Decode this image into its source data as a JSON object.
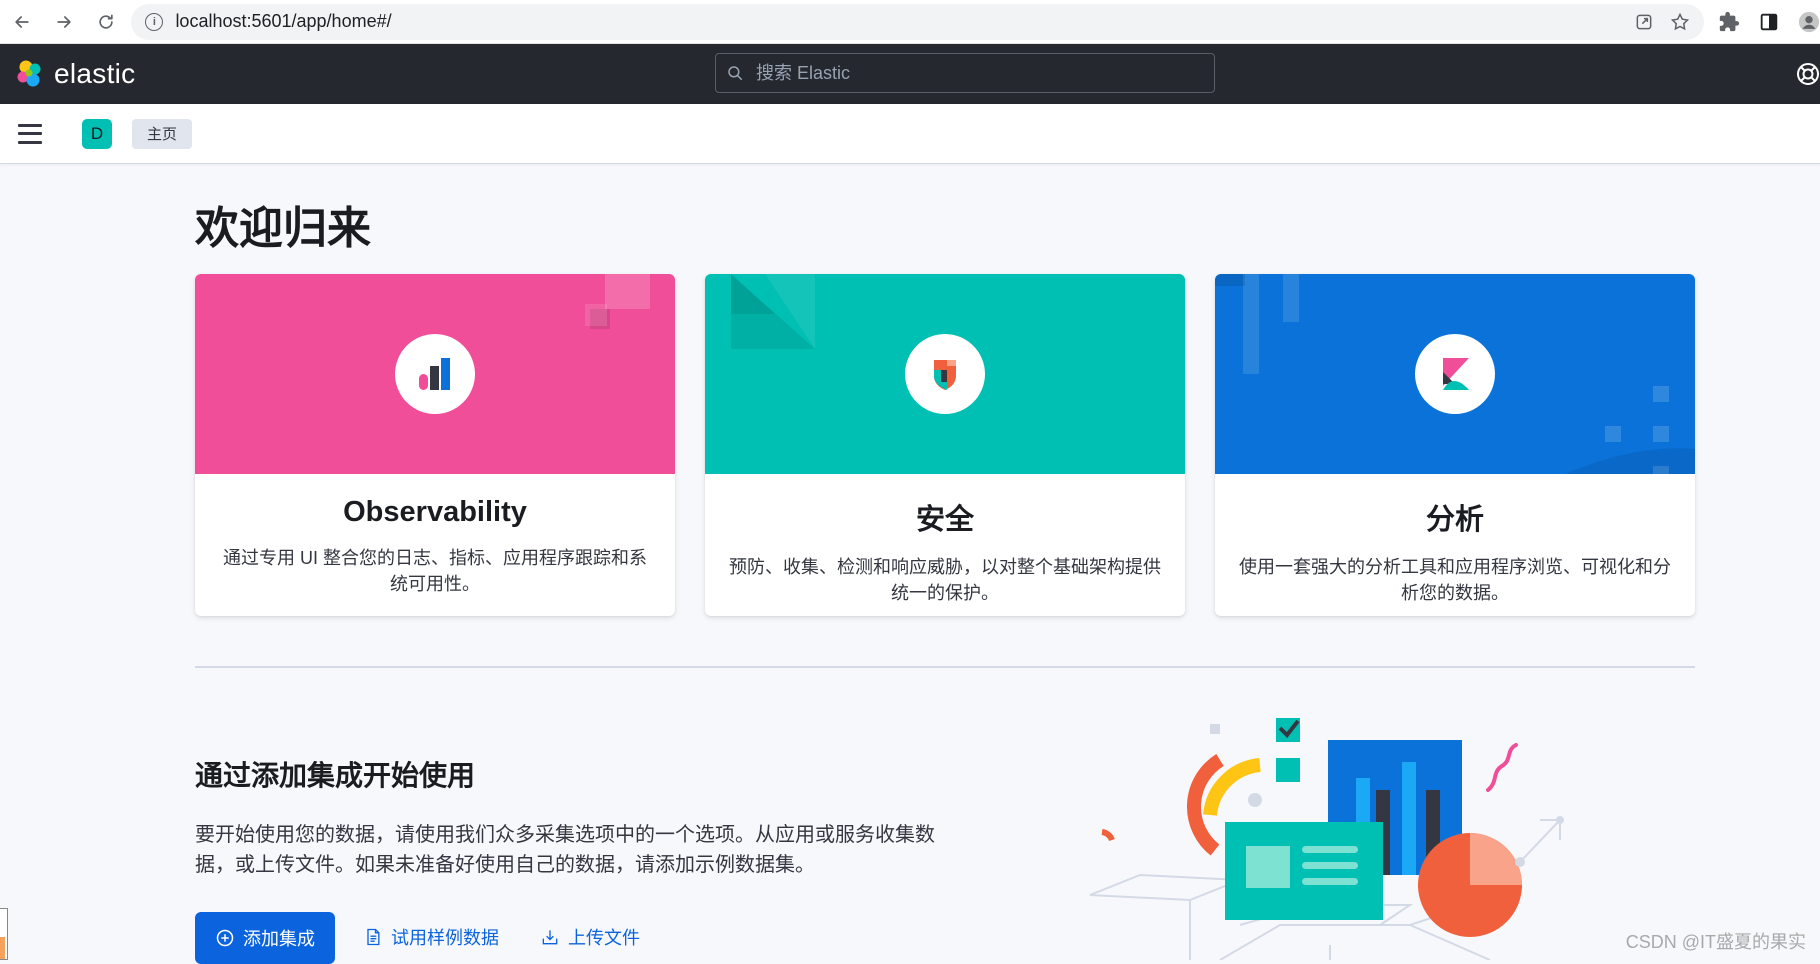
{
  "browser": {
    "url": "localhost:5601/app/home#/"
  },
  "header": {
    "logo_text": "elastic",
    "search_placeholder": "搜索 Elastic"
  },
  "subheader": {
    "space_initial": "D",
    "breadcrumb": "主页"
  },
  "main": {
    "title": "欢迎归来",
    "cards": [
      {
        "title": "Observability",
        "description": "通过专用 UI 整合您的日志、指标、应用程序跟踪和系统可用性。",
        "color": "#f04e98",
        "icon": "observability-logo-icon"
      },
      {
        "title": "安全",
        "description": "预防、收集、检测和响应威胁，以对整个基础架构提供统一的保护。",
        "color": "#00bfb3",
        "icon": "security-logo-icon"
      },
      {
        "title": "分析",
        "description": "使用一套强大的分析工具和应用程序浏览、可视化和分析您的数据。",
        "color": "#0b72d9",
        "icon": "kibana-logo-icon"
      }
    ],
    "getting_started": {
      "title": "通过添加集成开始使用",
      "description": "要开始使用您的数据，请使用我们众多采集选项中的一个选项。从应用或服务收集数据，或上传文件。如果未准备好使用自己的数据，请添加示例数据集。",
      "add_integrations": "添加集成",
      "try_sample_data": "试用样例数据",
      "upload_file": "上传文件"
    }
  },
  "watermark": "CSDN @IT盛夏的果实",
  "colors": {
    "header_bg": "#25282f",
    "primary": "#0b64dd",
    "accent": "#00bfb3"
  }
}
